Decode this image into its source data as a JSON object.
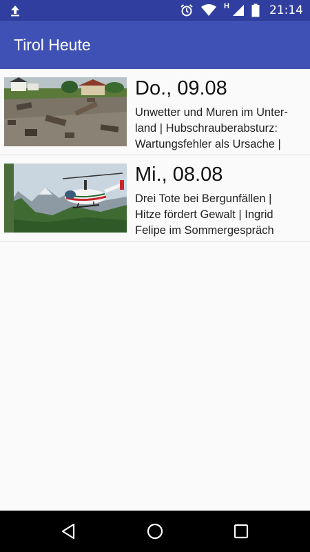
{
  "status_bar": {
    "time": "21:14",
    "network_type": "H",
    "icons": [
      "upload-icon",
      "alarm-icon",
      "wifi-icon",
      "signal-icon",
      "battery-icon"
    ]
  },
  "app_bar": {
    "title": "Tirol Heute",
    "color": "#3f51b5"
  },
  "episodes": [
    {
      "date": "Do., 09.08",
      "description": "Unwetter und Muren im Unter-land | Hubschrauberabsturz: Wartungsfehler als Ursache |",
      "thumbnail": "mudslide-image"
    },
    {
      "date": "Mi., 08.08",
      "description": "Drei Tote bei Bergunfällen | Hitze fördert Gewalt | Ingrid Felipe im Sommergespräch",
      "thumbnail": "helicopter-image"
    }
  ],
  "nav_bar": {
    "icons": [
      "back-icon",
      "home-icon",
      "recents-icon"
    ]
  }
}
